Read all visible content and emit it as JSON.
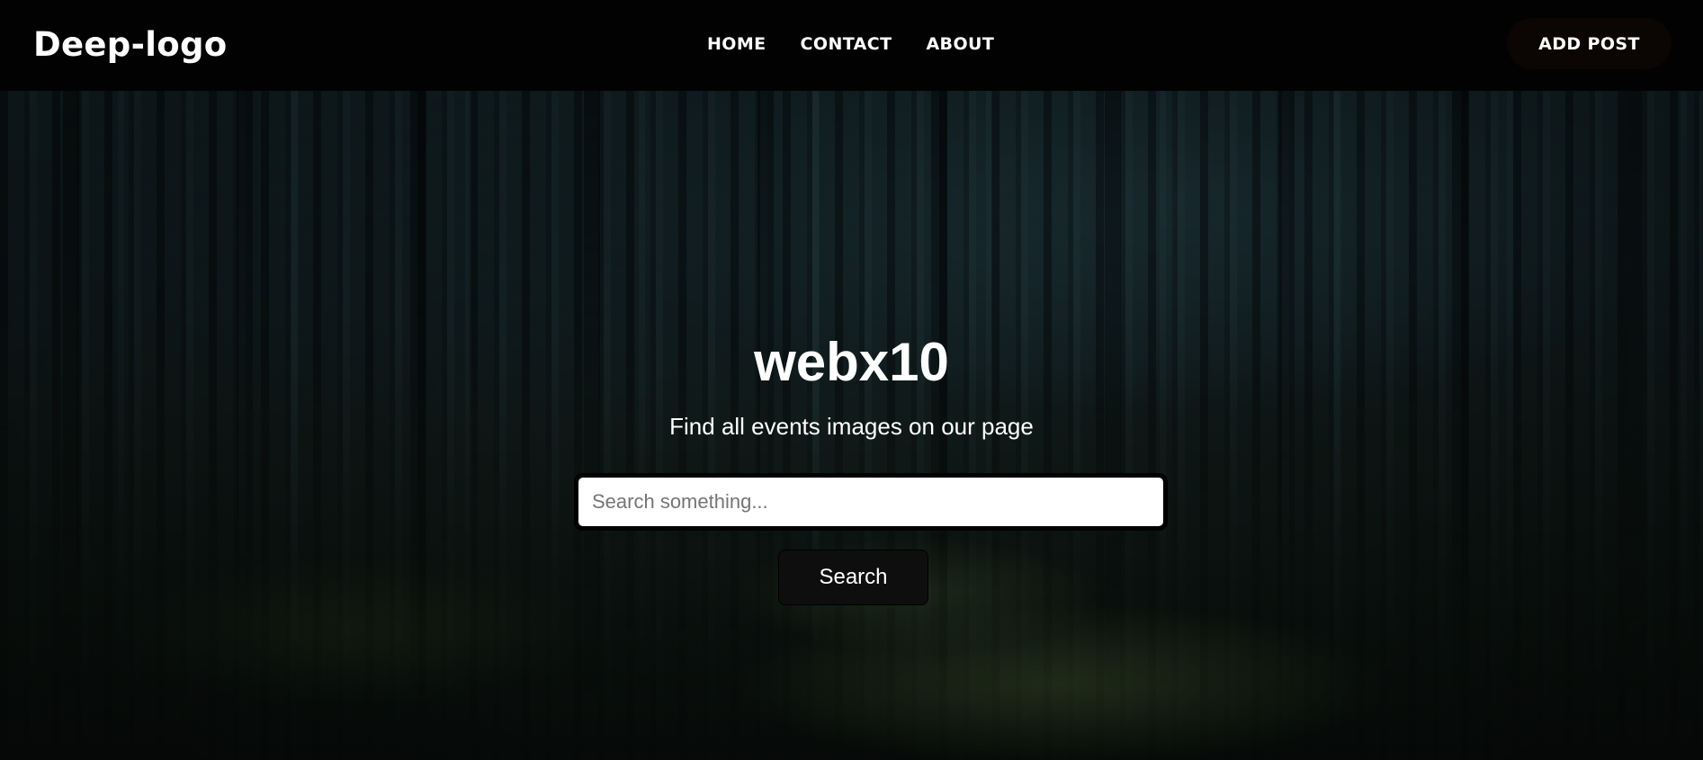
{
  "navbar": {
    "logo_text": "Deep-logo",
    "links": [
      {
        "label": "HOME"
      },
      {
        "label": "CONTACT"
      },
      {
        "label": "ABOUT"
      }
    ],
    "add_post_label": "ADD POST"
  },
  "hero": {
    "title": "webx10",
    "subtitle": "Find all events images on our page",
    "search": {
      "value": "",
      "placeholder": "Search something..."
    },
    "search_button_label": "Search"
  },
  "colors": {
    "navbar_bg": "#020202",
    "text": "#ffffff",
    "button_bg": "#0e0e0e",
    "input_bg": "#ffffff"
  }
}
